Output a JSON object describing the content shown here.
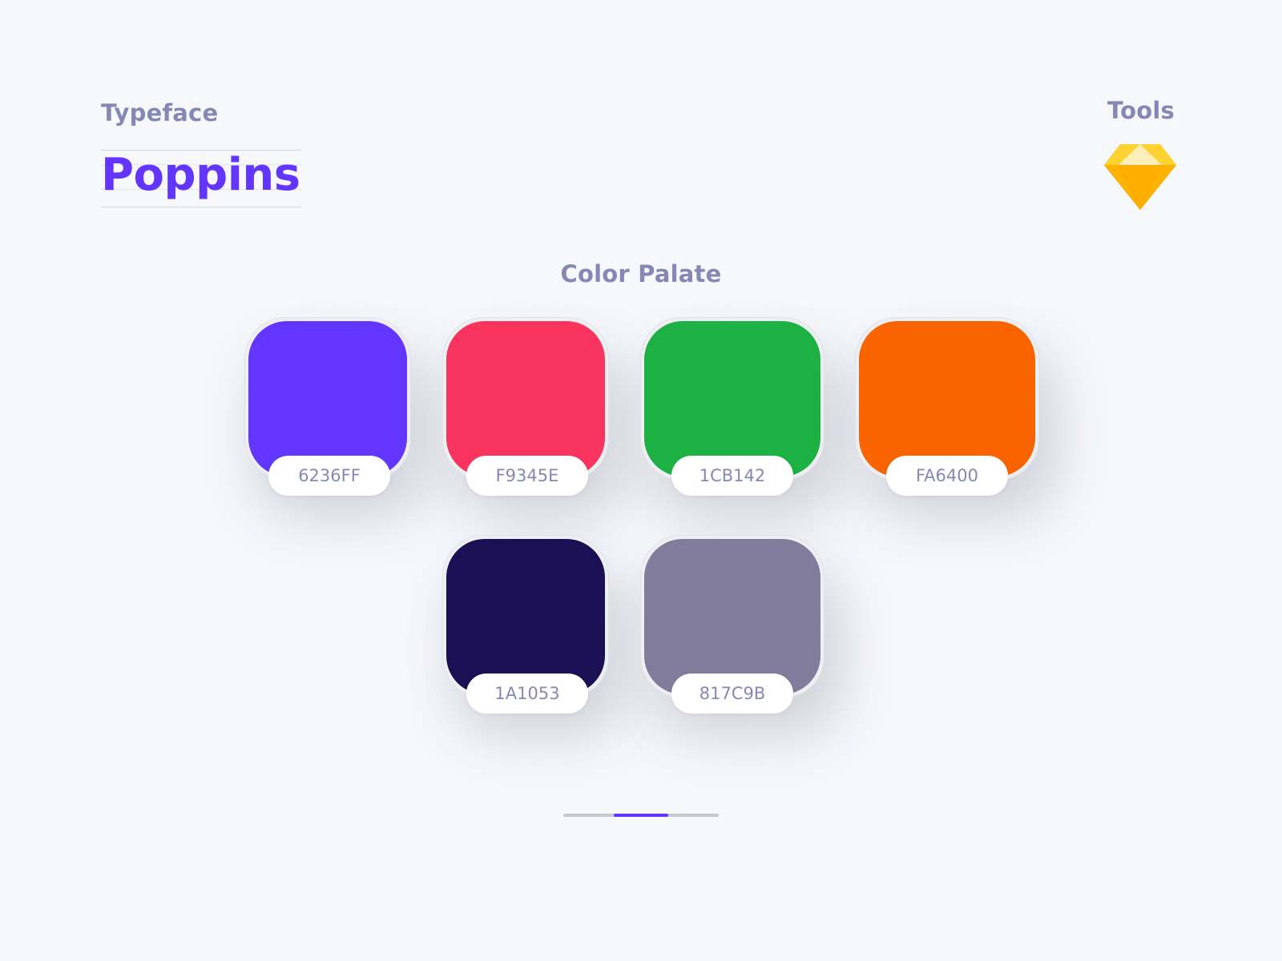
{
  "typeface": {
    "label": "Typeface",
    "font_name": "Poppins"
  },
  "tools": {
    "label": "Tools",
    "icon": "sketch-diamond-icon"
  },
  "palette": {
    "label": "Color Palate",
    "swatches": [
      {
        "hex": "6236FF",
        "color": "#6236FF"
      },
      {
        "hex": "F9345E",
        "color": "#F9345E"
      },
      {
        "hex": "1CB142",
        "color": "#1CB142"
      },
      {
        "hex": "FA6400",
        "color": "#FA6400"
      },
      {
        "hex": "1A1053",
        "color": "#1A1053"
      },
      {
        "hex": "817C9B",
        "color": "#817C9B"
      }
    ]
  },
  "pager": {
    "total": 3,
    "active": 2,
    "active_color": "#6236FF"
  }
}
